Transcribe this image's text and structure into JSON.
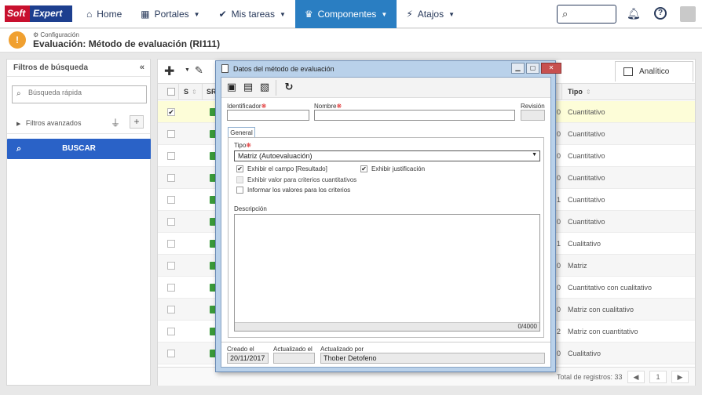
{
  "logo": {
    "part1": "Soft",
    "part2": "Expert"
  },
  "nav": {
    "home": "Home",
    "portales": "Portales",
    "tareas": "Mis tareas",
    "componentes": "Componentes",
    "atajos": "Atajos"
  },
  "header": {
    "breadcrumb": "Configuración",
    "title": "Evaluación: Método de evaluación (RI111)"
  },
  "filters": {
    "title": "Filtros de búsqueda",
    "quick_search_placeholder": "Búsqueda rápida",
    "advanced": "Filtros avanzados",
    "search_button": "BUSCAR"
  },
  "grid": {
    "tab_label": "Analítico",
    "columns": {
      "s": "S",
      "sr": "SR",
      "tipo": "Tipo"
    },
    "rows": [
      {
        "num": "0",
        "tipo": "Cuantitativo",
        "checked": true
      },
      {
        "num": "0",
        "tipo": "Cuantitativo",
        "checked": false
      },
      {
        "num": "0",
        "tipo": "Cuantitativo",
        "checked": false
      },
      {
        "num": "0",
        "tipo": "Cuantitativo",
        "checked": false
      },
      {
        "num": "1",
        "tipo": "Cuantitativo",
        "checked": false
      },
      {
        "num": "0",
        "tipo": "Cuantitativo",
        "checked": false
      },
      {
        "num": "1",
        "tipo": "Cualitativo",
        "checked": false
      },
      {
        "num": "0",
        "tipo": "Matriz",
        "checked": false
      },
      {
        "num": "0",
        "tipo": "Cuantitativo con cualitativo",
        "checked": false
      },
      {
        "num": "0",
        "tipo": "Matriz con cualitativo",
        "checked": false
      },
      {
        "num": "2",
        "tipo": "Matriz con cuantitativo",
        "checked": false
      },
      {
        "num": "0",
        "tipo": "Cualitativo",
        "checked": false
      }
    ],
    "total": "Total de registros: 33",
    "page": "1"
  },
  "modal": {
    "title": "Datos del método de evaluación",
    "identificador_label": "Identificador",
    "nombre_label": "Nombre",
    "revision_label": "Revisión",
    "identificador_value": "",
    "nombre_value": "",
    "revision_value": "",
    "tab_general": "General",
    "tipo_label": "Tipo",
    "tipo_value": "Matriz (Autoevaluación)",
    "chk_exhibir_campo": "Exhibir el campo [Resultado]",
    "chk_exhibir_justificacion": "Exhibir justificación",
    "chk_valor_criterios": "Exhibir valor para criterios cuantitativos",
    "chk_informar_valores": "Informar los valores para los criterios",
    "descripcion_label": "Descripción",
    "descripcion_count": "0/4000",
    "creado_label": "Creado el",
    "creado_value": "20/11/2017",
    "actualizado_label": "Actualizado el",
    "actualizado_value": "",
    "actualizado_por_label": "Actualizado por",
    "actualizado_por_value": "Thober Detofeno"
  }
}
